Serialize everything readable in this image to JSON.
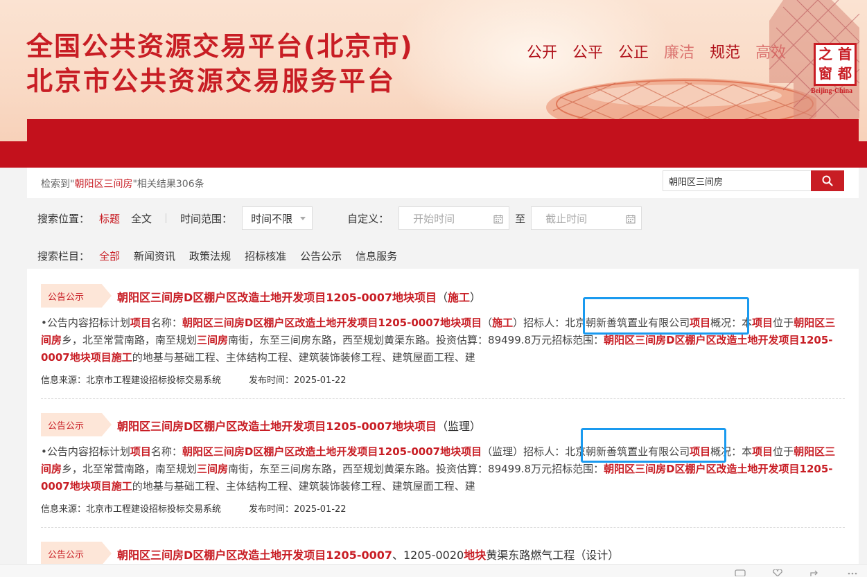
{
  "header": {
    "title_line1": "全国公共资源交易平台(北京市)",
    "title_line2": "北京市公共资源交易服务平台",
    "slogans": [
      "公开",
      "公平",
      "公正",
      "廉洁",
      "规范",
      "高效"
    ],
    "seal_chars": [
      "之",
      "首",
      "窗",
      "都"
    ],
    "seal_caption": "Beijing·China"
  },
  "search": {
    "summary_prefix": "检索到\"",
    "keyword": "朝阳区三间房",
    "summary_suffix": "\"相关结果306条",
    "value": "朝阳区三间房"
  },
  "filters": {
    "position_label": "搜索位置：",
    "position_options": [
      "标题",
      "全文"
    ],
    "time_label": "时间范围：",
    "time_select": "时间不限",
    "custom_label": "自定义：",
    "start_placeholder": "开始时间",
    "to_label": "至",
    "end_placeholder": "截止时间",
    "category_label": "搜索栏目：",
    "categories": [
      "全部",
      "新闻资讯",
      "政策法规",
      "招标核准",
      "公告公示",
      "信息服务"
    ]
  },
  "results": [
    {
      "tag": "公告公示",
      "title_main": "朝阳区三间房D区棚户区改造土地开发项目1205-0007地块项目",
      "title_paren_open": "（",
      "title_suffix": "施工",
      "title_paren_close": "）",
      "body": [
        {
          "t": "•公告内容招标计划",
          "h": false
        },
        {
          "t": "项目",
          "h": true
        },
        {
          "t": "名称：",
          "h": false
        },
        {
          "t": "朝阳区三间房D区棚户区改造土地开发项目1205-0007地块项目",
          "h": true
        },
        {
          "t": "（",
          "h": false
        },
        {
          "t": "施工",
          "h": true
        },
        {
          "t": "）招标人：北京朝新善筑置业有限公司",
          "h": false
        },
        {
          "t": "项目",
          "h": true
        },
        {
          "t": "概况：本",
          "h": false
        },
        {
          "t": "项目",
          "h": true
        },
        {
          "t": "位于",
          "h": false
        },
        {
          "t": "朝阳区三间房",
          "h": true
        },
        {
          "t": "乡，北至常营南路，南至规划",
          "h": false
        },
        {
          "t": "三间房",
          "h": true
        },
        {
          "t": "南街，东至三间房东路，西至规划黄渠东路。投资估算：89499.8万元招标范围：",
          "h": false
        },
        {
          "t": "朝阳区三间房D区棚户区改造土地开发项目1205-0007地块项目施工",
          "h": true
        },
        {
          "t": "的地基与基础工程、主体结构工程、建筑装饰装修工程、建筑屋面工程、建",
          "h": false
        }
      ],
      "source": "信息来源：北京市工程建设招标投标交易系统",
      "date": "发布时间：2025-01-22"
    },
    {
      "tag": "公告公示",
      "title_main": "朝阳区三间房D区棚户区改造土地开发项目1205-0007地块项目",
      "title_paren_open": "（",
      "title_suffix": "监理",
      "title_paren_close": "）",
      "body": [
        {
          "t": "•公告内容招标计划",
          "h": false
        },
        {
          "t": "项目",
          "h": true
        },
        {
          "t": "名称：",
          "h": false
        },
        {
          "t": "朝阳区三间房D区棚户区改造土地开发项目1205-0007地块项目",
          "h": true
        },
        {
          "t": "（监理）招标人：北京朝新善筑置业有限公司",
          "h": false
        },
        {
          "t": "项目",
          "h": true
        },
        {
          "t": "概况：本",
          "h": false
        },
        {
          "t": "项目",
          "h": true
        },
        {
          "t": "位于",
          "h": false
        },
        {
          "t": "朝阳区三间房",
          "h": true
        },
        {
          "t": "乡，北至常营南路，南至规划",
          "h": false
        },
        {
          "t": "三间房",
          "h": true
        },
        {
          "t": "南街，东至三间房东路，西至规划黄渠东路。投资估算：89499.8万元招标范围：",
          "h": false
        },
        {
          "t": "朝阳区三间房D区棚户区改造土地开发项目1205-0007地块项目施工",
          "h": true
        },
        {
          "t": "的地基与基础工程、主体结构工程、建筑装饰装修工程、建筑屋面工程、建",
          "h": false
        }
      ],
      "source": "信息来源：北京市工程建设招标投标交易系统",
      "date": "发布时间：2025-01-22"
    }
  ],
  "third_result": {
    "tag": "公告公示",
    "title_a": "朝阳区三间房D区棚户区改造土地开发项目1205-0007",
    "title_b": "、1205-0020",
    "title_c": "地块",
    "title_d": "黄渠东路燃气工程（设计）"
  },
  "colors": {
    "brand_red": "#c81d24",
    "nav_red": "#c3111c",
    "annotation_blue": "#1a9aef"
  }
}
